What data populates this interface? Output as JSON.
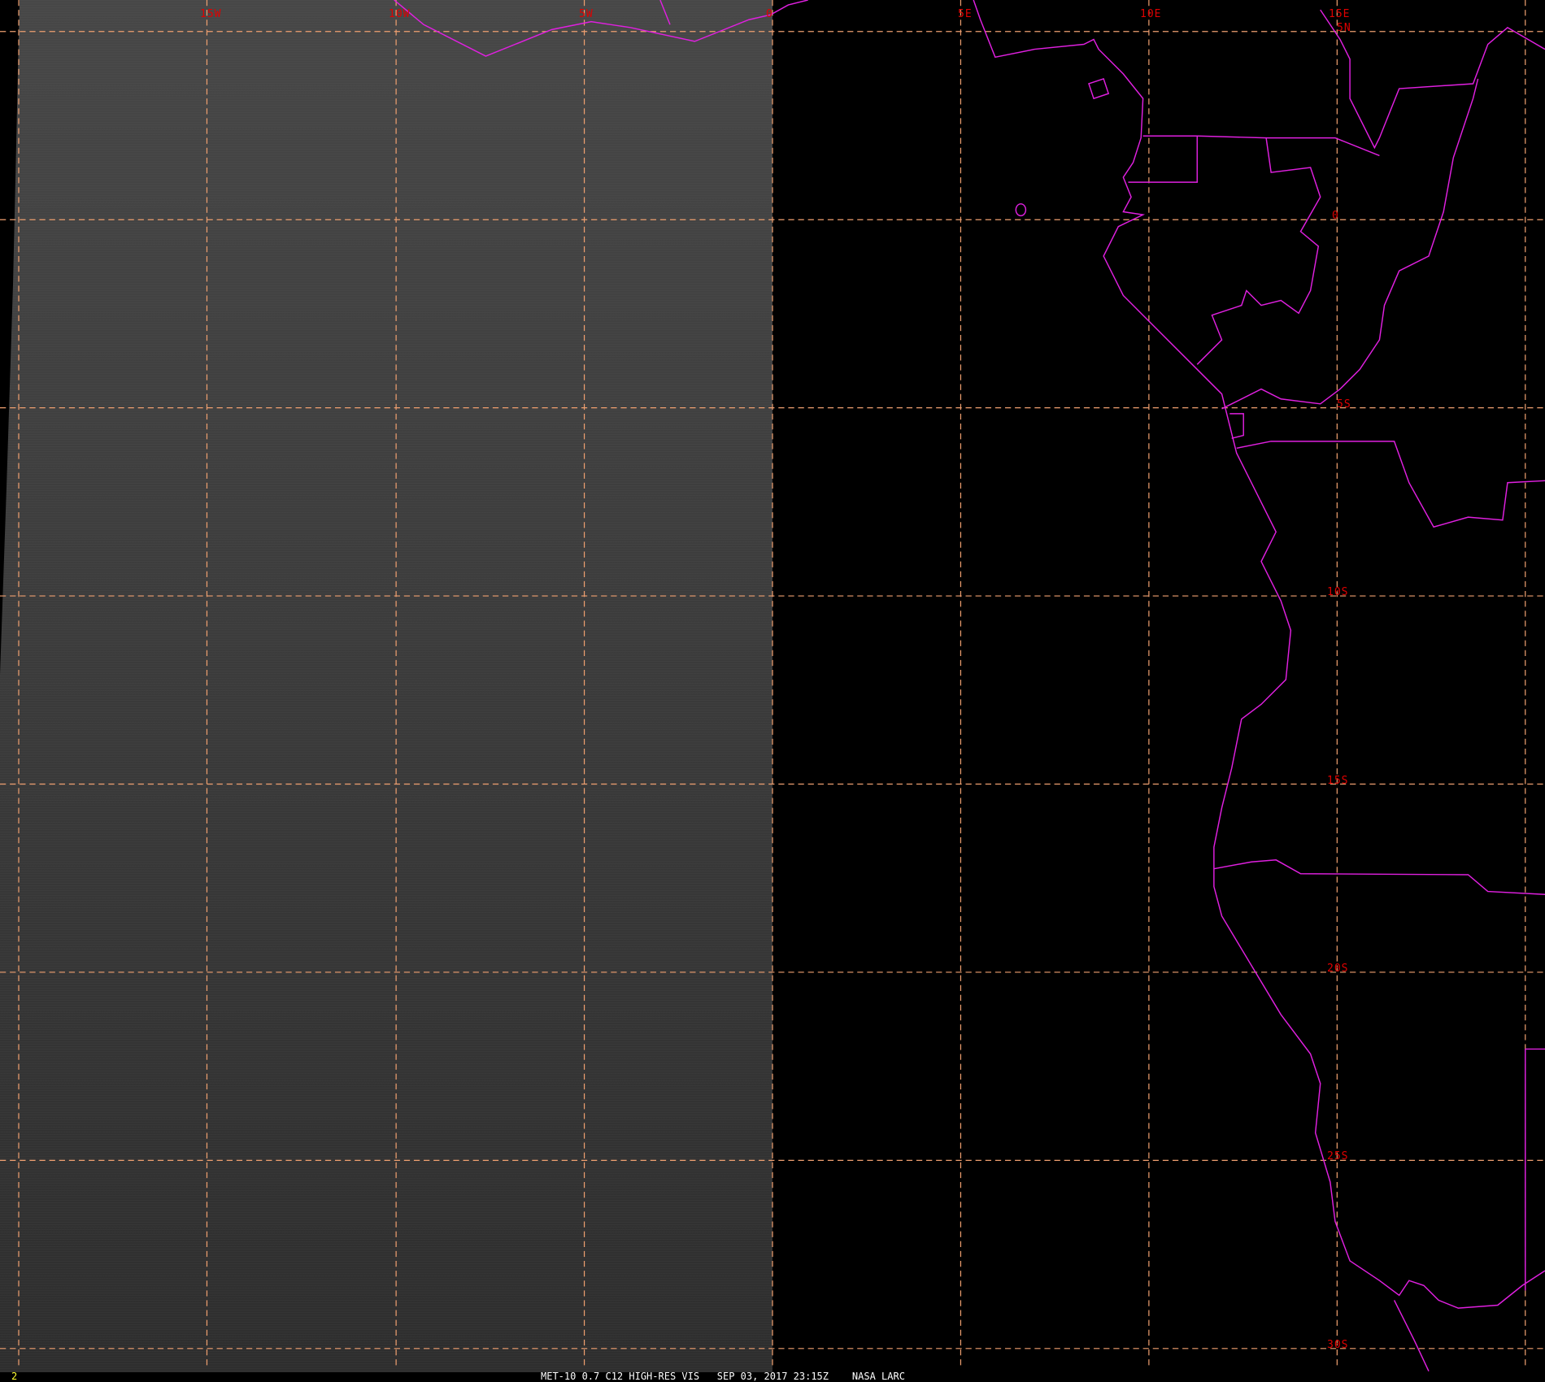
{
  "frame_number": "2",
  "caption": "MET-10 0.7 C12 HIGH-RES VIS   SEP 03, 2017 23:15Z    NASA LARC",
  "longitude_labels": [
    "15W",
    "10W",
    "5W",
    "0",
    "5E",
    "10E",
    "15E"
  ],
  "latitude_labels": [
    "5N",
    "0",
    "5S",
    "10S",
    "15S",
    "20S",
    "25S",
    "30S"
  ],
  "colors": {
    "grid": "#f0a070",
    "coastline": "#e020e0",
    "labels": "#e00000",
    "frame": "#ffff30"
  }
}
